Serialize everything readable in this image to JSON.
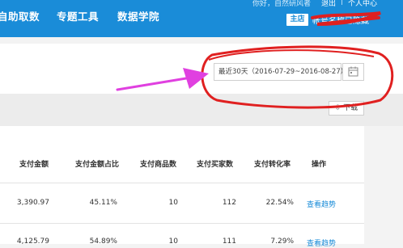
{
  "nav": {
    "items": [
      "自助取数",
      "专题工具",
      "数据学院"
    ],
    "greeting": "你好，自然研风者",
    "logout": "退出",
    "personal_center": "个人中心",
    "store_badge": "主店",
    "account_name": "帐号名称已隐藏"
  },
  "toolbar": {
    "date_range": "最近30天（2016-07-29~2016-08-27）",
    "download_label": "下载"
  },
  "table": {
    "columns": [
      "支付金额",
      "支付金额占比",
      "支付商品数",
      "支付买家数",
      "支付转化率",
      "操作"
    ],
    "rows": [
      {
        "amount": "3,390.97",
        "ratio": "45.11%",
        "goods": "10",
        "buyers": "112",
        "conversion": "22.54%",
        "action": "查看趋势"
      },
      {
        "amount": "4,125.79",
        "ratio": "54.89%",
        "goods": "10",
        "buyers": "111",
        "conversion": "7.29%",
        "action": "查看趋势"
      }
    ]
  },
  "colors": {
    "brand_blue": "#1a8cd8",
    "annotation_red": "#e02020",
    "annotation_magenta": "#e040e0"
  }
}
